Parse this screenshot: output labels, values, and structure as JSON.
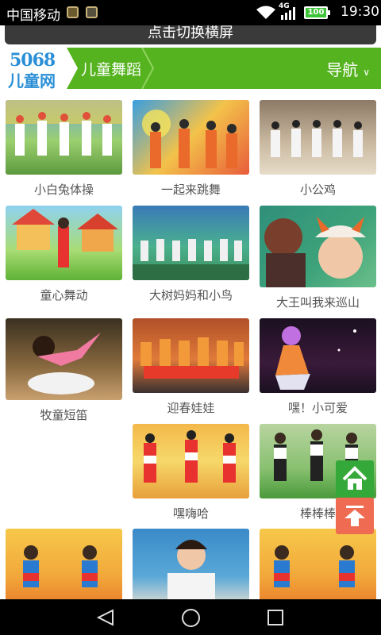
{
  "status_bar": {
    "carrier": "中国移动",
    "network": "4G",
    "battery": "100",
    "time": "19:30"
  },
  "banner": {
    "label": "点击切换横屏"
  },
  "header": {
    "logo_number": "5068",
    "logo_text": "儿童网",
    "breadcrumb": "儿童舞蹈",
    "nav_label": "导航"
  },
  "videos": [
    {
      "title": "小白兔体操"
    },
    {
      "title": "一起来跳舞"
    },
    {
      "title": "小公鸡"
    },
    {
      "title": "童心舞动"
    },
    {
      "title": "大树妈妈和小鸟"
    },
    {
      "title": "大王叫我来巡山"
    },
    {
      "title": "牧童短笛"
    },
    {
      "title": "迎春娃娃"
    },
    {
      "title": "嘿！小可爱"
    },
    {
      "title": "嘿嗨哈"
    },
    {
      "title": "棒棒棒"
    },
    {
      "title": ""
    },
    {
      "title": ""
    },
    {
      "title": ""
    }
  ],
  "icons": {
    "home": "home-icon",
    "top": "arrow-up-icon",
    "back": "back-triangle-icon",
    "home_nav": "circle-home-icon",
    "recent": "square-recent-icon"
  },
  "colors": {
    "header": "#55b31f",
    "home_button": "#35a83a",
    "top_button": "#ef6b51"
  }
}
